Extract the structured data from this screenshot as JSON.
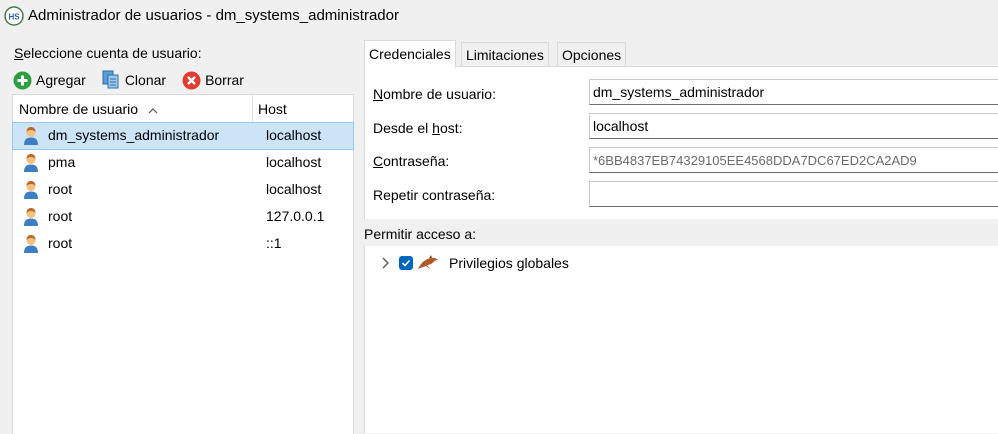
{
  "window": {
    "title": "Administrador de usuarios - dm_systems_administrador",
    "app_icon_text": "HS"
  },
  "left": {
    "select_label_prefix": "S",
    "select_label_rest": "eleccione cuenta de usuario:",
    "toolbar": {
      "add_label": "Agregar",
      "clone_label": "Clonar",
      "delete_label": "Borrar"
    },
    "columns": [
      "Nombre de usuario",
      "Host"
    ],
    "users": [
      {
        "name": "dm_systems_administrador",
        "host": "localhost",
        "selected": true
      },
      {
        "name": "pma",
        "host": "localhost",
        "selected": false
      },
      {
        "name": "root",
        "host": "localhost",
        "selected": false
      },
      {
        "name": "root",
        "host": "127.0.0.1",
        "selected": false
      },
      {
        "name": "root",
        "host": "::1",
        "selected": false
      }
    ]
  },
  "right": {
    "tabs": [
      "Credenciales",
      "Limitaciones",
      "Opciones SSL"
    ],
    "active_tab": "Credenciales",
    "form": {
      "username_label_u": "N",
      "username_label_rest": "ombre de usuario:",
      "username_value": "dm_systems_administrador",
      "host_label_pre": "Desde el ",
      "host_label_u": "h",
      "host_label_rest": "ost:",
      "host_value": "localhost",
      "password_label_u": "C",
      "password_label_rest": "ontraseña:",
      "password_value": "*6BB4837EB74329105EE4568DDA7DC67ED2CA2AD9",
      "repeat_label": "Repetir contraseña:",
      "repeat_value": ""
    },
    "access_label": "Permitir acceso a:",
    "privileges": {
      "label": "Privilegios globales",
      "checked": true
    }
  },
  "colors": {
    "selection": "#cce4f7",
    "checkbox": "#0067c0",
    "add_green": "#2e9e3e",
    "delete_red": "#e03c31"
  }
}
